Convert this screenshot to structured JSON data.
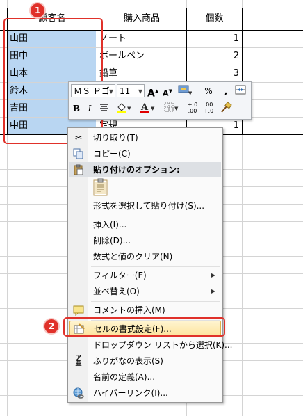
{
  "sheet": {
    "headers": [
      "顧客名",
      "購入商品",
      "個数"
    ],
    "rows": [
      {
        "customer": "山田",
        "product": "ノート",
        "qty": "1"
      },
      {
        "customer": "田中",
        "product": "ボールペン",
        "qty": "2"
      },
      {
        "customer": "山本",
        "product": "鉛筆",
        "qty": "3"
      },
      {
        "customer": "鈴木",
        "product": "",
        "qty": ""
      },
      {
        "customer": "吉田",
        "product": "",
        "qty": ""
      },
      {
        "customer": "中田",
        "product": "定規",
        "qty": "1"
      }
    ]
  },
  "mini_toolbar": {
    "font_name": "ＭＳ Ｐゴ",
    "font_size": "11",
    "grow_font": "A",
    "shrink_font": "A",
    "percent": "%",
    "comma": ",",
    "bold": "B",
    "italic": "I",
    "decimal_increase": "+.0\n.00",
    "decimal_decrease": ".00\n+.0"
  },
  "context_menu": {
    "items": [
      {
        "label": "切り取り(T)",
        "icon": "scissors-icon"
      },
      {
        "label": "コピー(C)",
        "icon": "copy-icon"
      },
      {
        "label": "貼り付けのオプション:",
        "icon": "paste-icon"
      },
      {
        "label": "形式を選択して貼り付け(S)..."
      },
      {
        "label": "挿入(I)..."
      },
      {
        "label": "削除(D)..."
      },
      {
        "label": "数式と値のクリア(N)"
      },
      {
        "label": "フィルター(E)",
        "submenu": true
      },
      {
        "label": "並べ替え(O)",
        "submenu": true
      },
      {
        "label": "コメントの挿入(M)",
        "icon": "comment-icon"
      },
      {
        "label": "セルの書式設定(F)...",
        "icon": "format-cells-icon"
      },
      {
        "label": "ドロップダウン リストから選択(K)..."
      },
      {
        "label": "ふりがなの表示(S)",
        "icon": "furigana-icon"
      },
      {
        "label": "名前の定義(A)..."
      },
      {
        "label": "ハイパーリンク(I)...",
        "icon": "hyperlink-icon"
      }
    ]
  },
  "annotations": {
    "badge_1": "1",
    "badge_2": "2",
    "color": "#e0312a"
  }
}
